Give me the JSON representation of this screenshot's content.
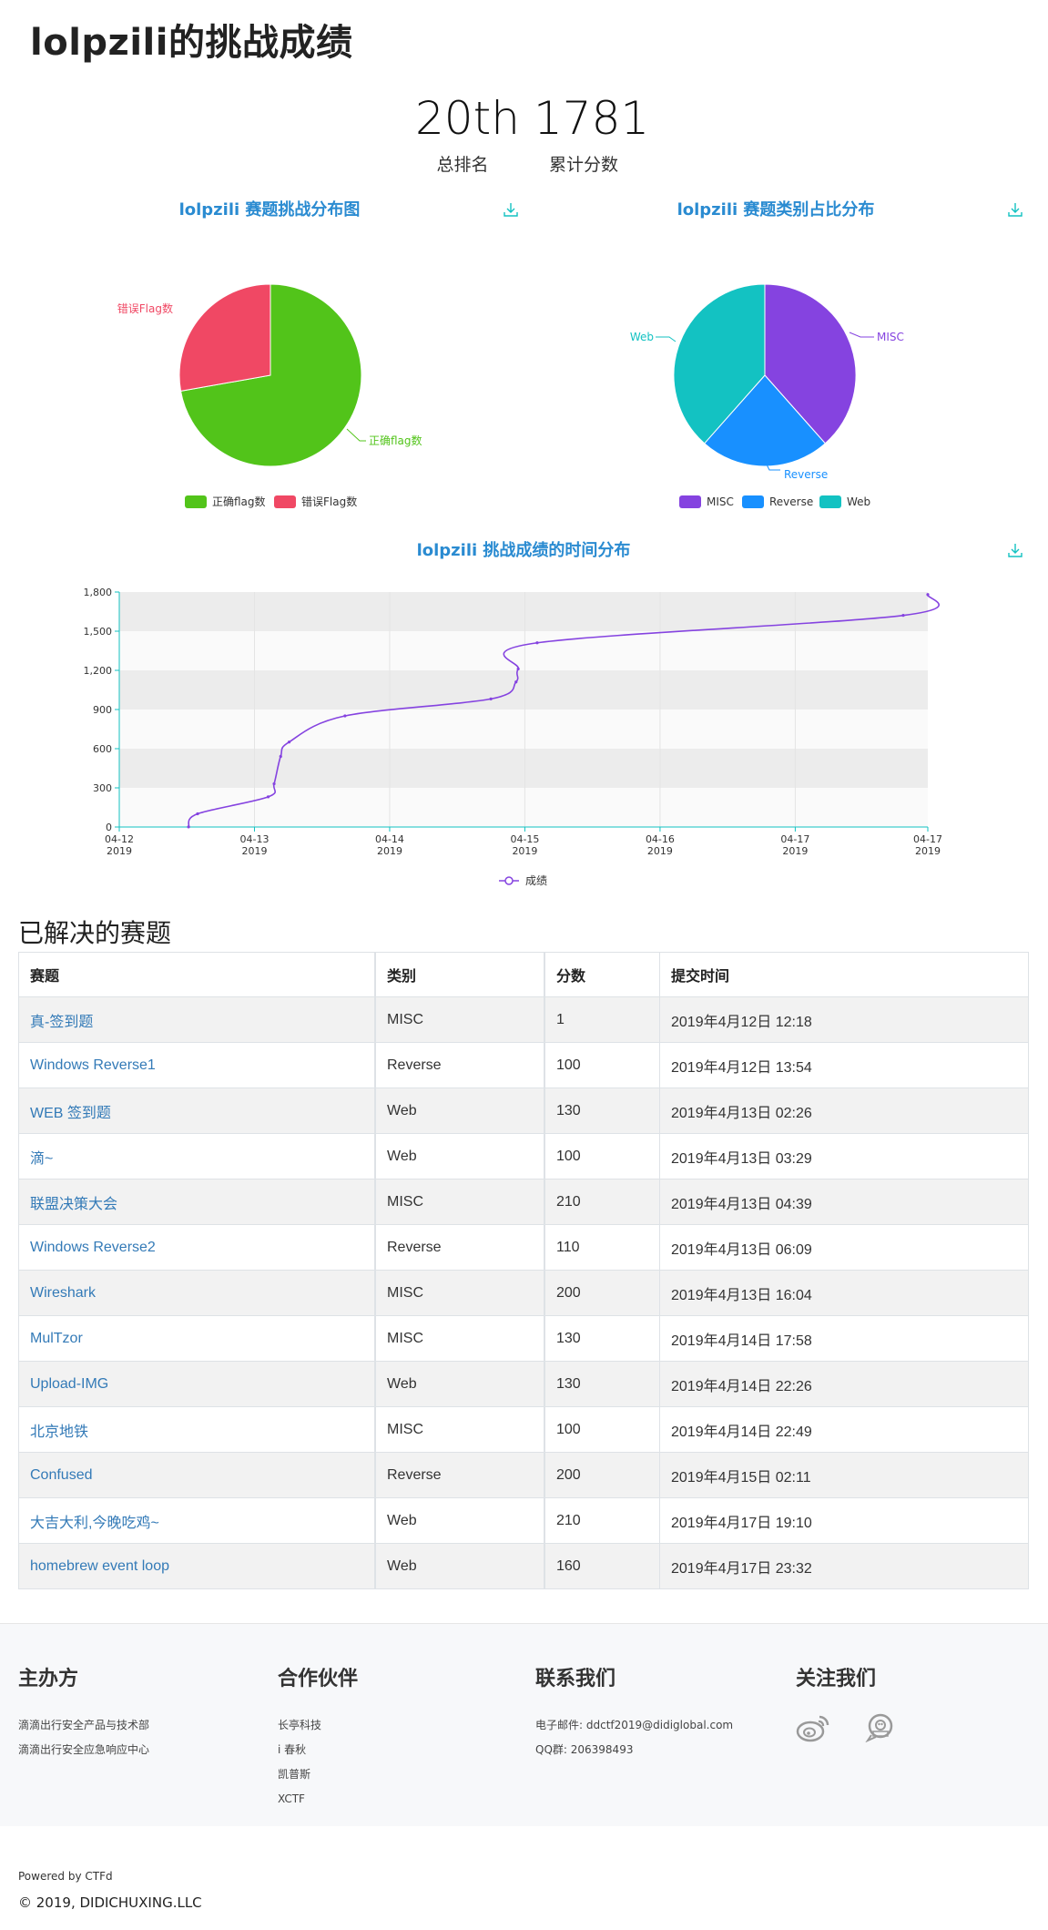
{
  "page": {
    "title": "lolpzili的挑战成绩"
  },
  "stats": {
    "rank_value": "20th",
    "rank_label": "总排名",
    "score_value": "1781",
    "score_label": "累计分数"
  },
  "charts": {
    "pie1": {
      "title": "lolpzili 赛题挑战分布图",
      "slices": [
        {
          "name": "正确flag数",
          "value": 13,
          "color": "#52c41a",
          "label": "正确flag数"
        },
        {
          "name": "错误Flag数",
          "value": 5,
          "color": "#f04864",
          "label": "错误Flag数"
        }
      ]
    },
    "pie2": {
      "title": "lolpzili 赛题类别占比分布",
      "slices": [
        {
          "name": "MISC",
          "value": 5,
          "color": "#8543e0"
        },
        {
          "name": "Reverse",
          "value": 3,
          "color": "#1890ff"
        },
        {
          "name": "Web",
          "value": 5,
          "color": "#13c2c2"
        }
      ]
    },
    "line": {
      "title": "lolpzili 挑战成绩的时间分布",
      "series_name": "成绩",
      "yticks": [
        "0",
        "300",
        "600",
        "900",
        "1,200",
        "1,500",
        "1,800"
      ],
      "xticks": [
        {
          "date": "04-12",
          "year": "2019"
        },
        {
          "date": "04-13",
          "year": "2019"
        },
        {
          "date": "04-14",
          "year": "2019"
        },
        {
          "date": "04-15",
          "year": "2019"
        },
        {
          "date": "04-16",
          "year": "2019"
        },
        {
          "date": "04-17",
          "year": "2019"
        },
        {
          "date": "04-17",
          "year": "2019"
        }
      ]
    }
  },
  "chart_data": [
    {
      "type": "pie",
      "title": "lolpzili 赛题挑战分布图",
      "labels": [
        "正确flag数",
        "错误Flag数"
      ],
      "values": [
        13,
        5
      ]
    },
    {
      "type": "pie",
      "title": "lolpzili 赛题类别占比分布",
      "labels": [
        "MISC",
        "Reverse",
        "Web"
      ],
      "values": [
        5,
        3,
        5
      ]
    },
    {
      "type": "line",
      "title": "lolpzili 挑战成绩的时间分布",
      "series": [
        {
          "name": "成绩",
          "x": [
            "2019-04-12 12:18",
            "2019-04-12 13:54",
            "2019-04-13 02:26",
            "2019-04-13 03:29",
            "2019-04-13 04:39",
            "2019-04-13 06:09",
            "2019-04-13 16:04",
            "2019-04-14 17:58",
            "2019-04-14 22:26",
            "2019-04-14 22:49",
            "2019-04-15 02:11",
            "2019-04-17 19:10",
            "2019-04-17 23:32"
          ],
          "values": [
            1,
            101,
            231,
            331,
            541,
            651,
            851,
            981,
            1111,
            1211,
            1411,
            1621,
            1781
          ]
        }
      ],
      "ylim": [
        0,
        1800
      ],
      "grid": true,
      "legend": "bottom"
    }
  ],
  "solved": {
    "heading": "已解决的赛题",
    "columns": [
      "赛题",
      "类别",
      "分数",
      "提交时间"
    ],
    "rows": [
      {
        "name": "真-签到题",
        "category": "MISC",
        "score": "1",
        "time": "2019年4月12日 12:18"
      },
      {
        "name": "Windows Reverse1",
        "category": "Reverse",
        "score": "100",
        "time": "2019年4月12日 13:54"
      },
      {
        "name": "WEB 签到题",
        "category": "Web",
        "score": "130",
        "time": "2019年4月13日 02:26"
      },
      {
        "name": "滴~",
        "category": "Web",
        "score": "100",
        "time": "2019年4月13日 03:29"
      },
      {
        "name": "联盟决策大会",
        "category": "MISC",
        "score": "210",
        "time": "2019年4月13日 04:39"
      },
      {
        "name": "Windows Reverse2",
        "category": "Reverse",
        "score": "110",
        "time": "2019年4月13日 06:09"
      },
      {
        "name": "Wireshark",
        "category": "MISC",
        "score": "200",
        "time": "2019年4月13日 16:04"
      },
      {
        "name": "MulTzor",
        "category": "MISC",
        "score": "130",
        "time": "2019年4月14日 17:58"
      },
      {
        "name": "Upload-IMG",
        "category": "Web",
        "score": "130",
        "time": "2019年4月14日 22:26"
      },
      {
        "name": "北京地铁",
        "category": "MISC",
        "score": "100",
        "time": "2019年4月14日 22:49"
      },
      {
        "name": "Confused",
        "category": "Reverse",
        "score": "200",
        "time": "2019年4月15日 02:11"
      },
      {
        "name": "大吉大利,今晚吃鸡~",
        "category": "Web",
        "score": "210",
        "time": "2019年4月17日 19:10"
      },
      {
        "name": "homebrew event loop",
        "category": "Web",
        "score": "160",
        "time": "2019年4月17日 23:32"
      }
    ]
  },
  "footer": {
    "organizer": {
      "title": "主办方",
      "lines": [
        "滴滴出行安全产品与技术部",
        "滴滴出行安全应急响应中心"
      ]
    },
    "partners": {
      "title": "合作伙伴",
      "lines": [
        "长亭科技",
        "i 春秋",
        "凯普斯",
        "XCTF"
      ]
    },
    "contact": {
      "title": "联系我们",
      "lines": [
        "电子邮件: ddctf2019@didiglobal.com",
        "QQ群: 206398493"
      ]
    },
    "follow": {
      "title": "关注我们",
      "icons": [
        "weibo-icon",
        "wechat-icon"
      ]
    },
    "powered": "Powered by CTFd",
    "copyright": "© 2019, DIDICHUXING.LLC"
  },
  "colors": {
    "chart_title": "#2a8bd1",
    "line": "#8543e0",
    "link": "#337ab7",
    "icon": "#13c2c2"
  }
}
